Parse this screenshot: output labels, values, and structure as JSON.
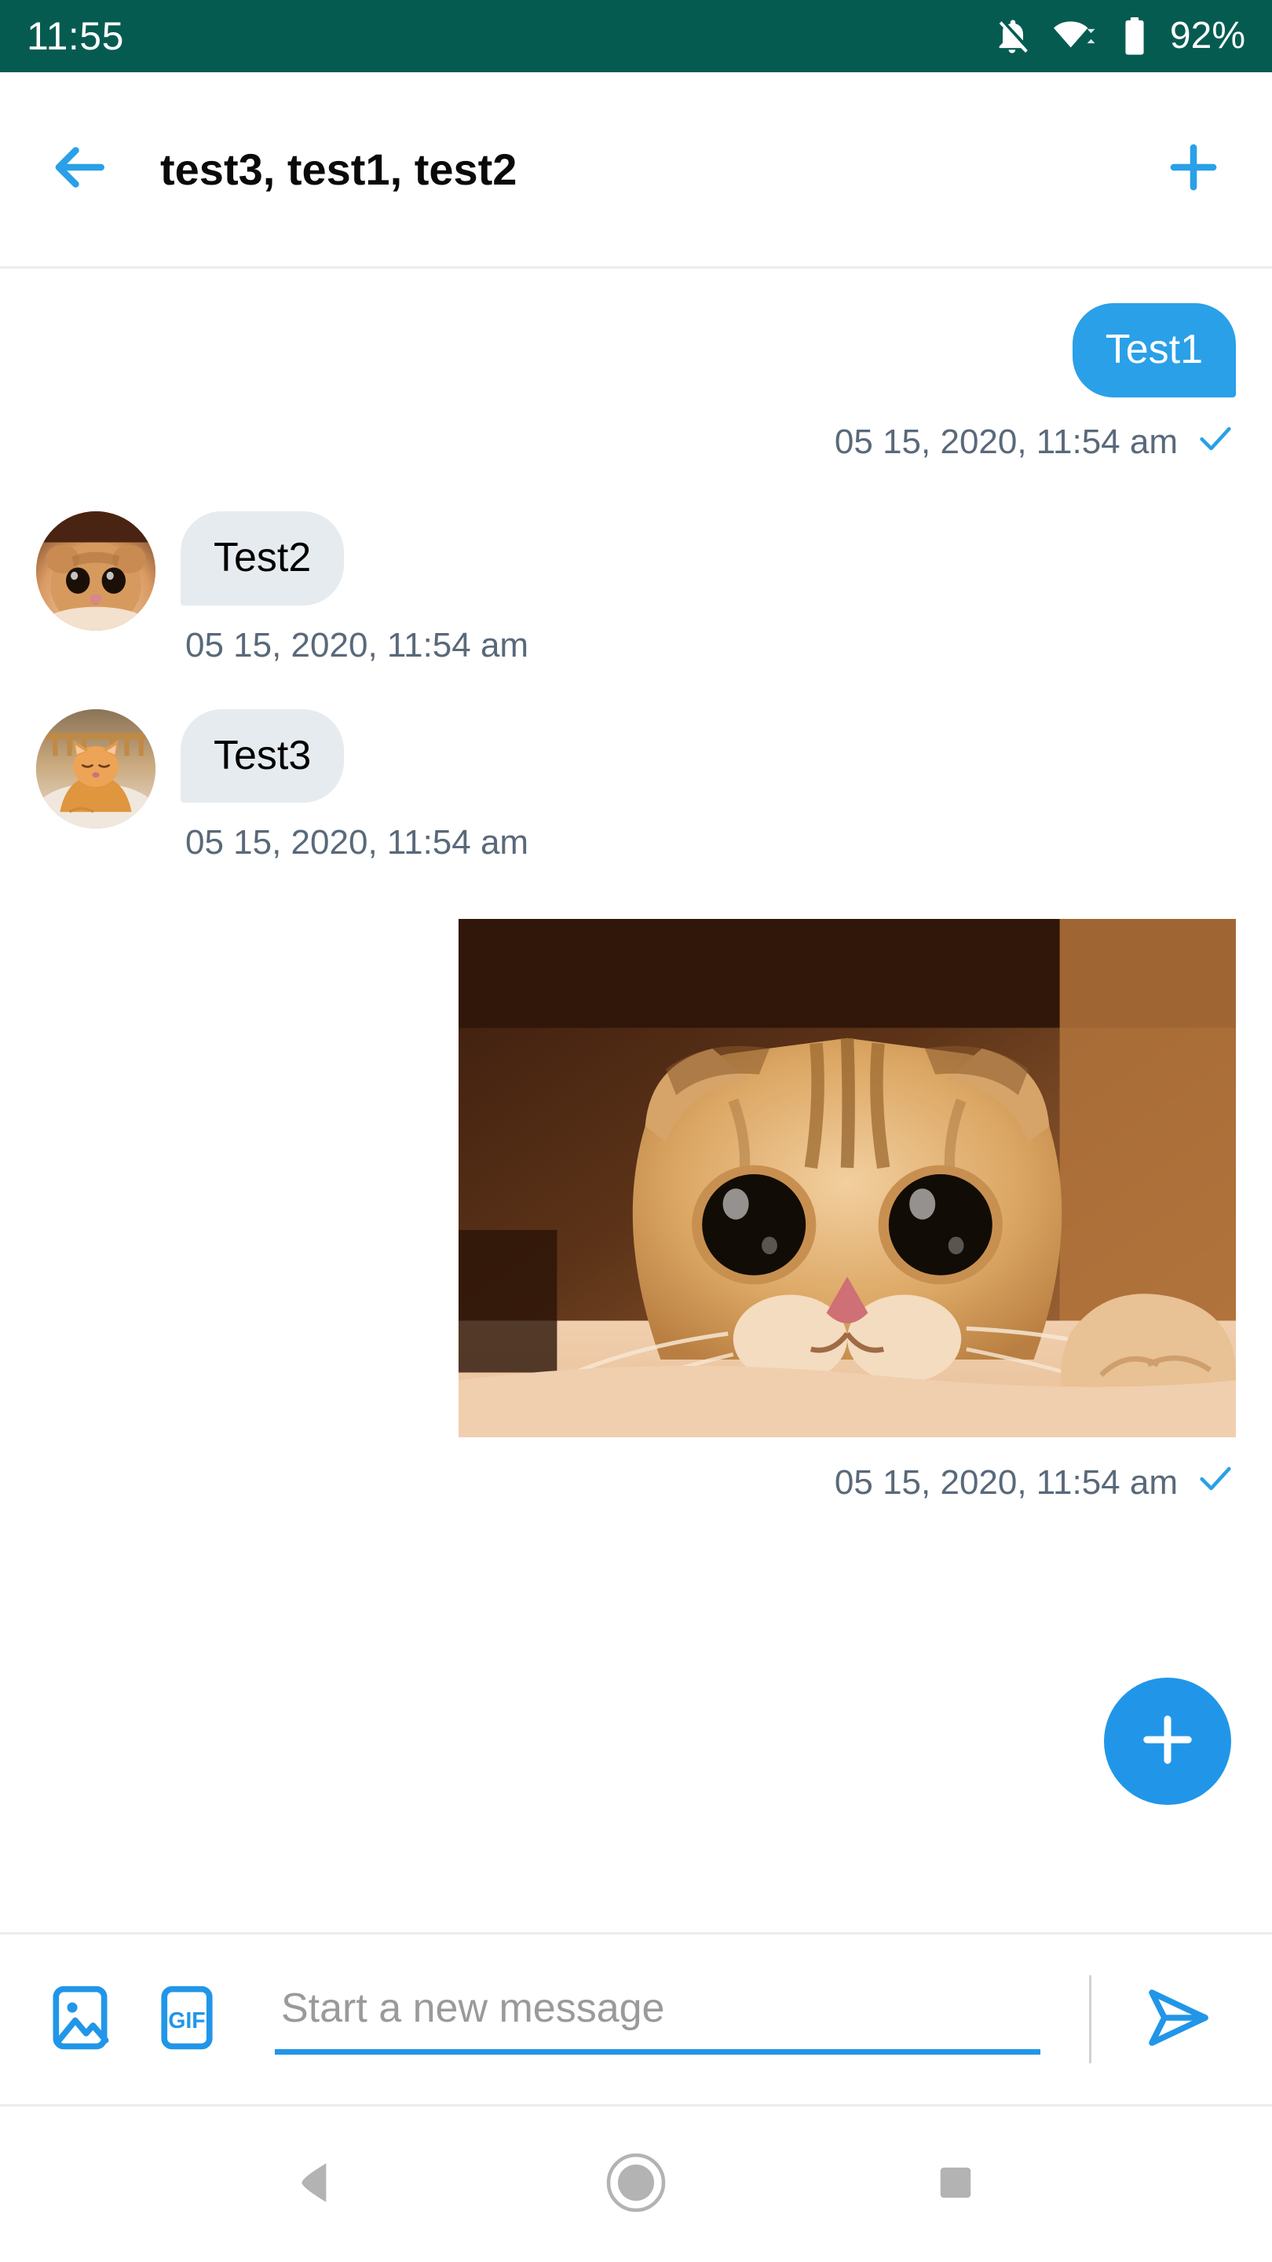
{
  "status_bar": {
    "time": "11:55",
    "battery_percent": "92%",
    "icons": [
      "notifications-off-icon",
      "wifi-icon",
      "battery-icon"
    ],
    "background_color": "#065B51"
  },
  "toolbar": {
    "back_label": "back-arrow",
    "title": "test3, test1, test2",
    "add_label": "add",
    "accent_color": "#2AA0E8"
  },
  "conversation": {
    "messages": [
      {
        "id": "m1",
        "direction": "outgoing",
        "type": "text",
        "text": "Test1",
        "timestamp": "05 15, 2020, 11:54 am",
        "status": "sent",
        "bubble_color": "#2AA0E8",
        "text_color": "#ffffff"
      },
      {
        "id": "m2",
        "direction": "incoming",
        "type": "text",
        "text": "Test2",
        "timestamp": "05 15, 2020, 11:54 am",
        "avatar": "cat-face-avatar",
        "bubble_color": "#E6EBEF",
        "text_color": "#000000"
      },
      {
        "id": "m3",
        "direction": "incoming",
        "type": "text",
        "text": "Test3",
        "timestamp": "05 15, 2020, 11:54 am",
        "avatar": "cat-lying-avatar",
        "bubble_color": "#E6EBEF",
        "text_color": "#000000"
      },
      {
        "id": "m4",
        "direction": "outgoing",
        "type": "image",
        "image_alt": "cat-photo",
        "timestamp": "05 15, 2020, 11:54 am",
        "status": "sent"
      }
    ],
    "timestamp_color": "#59697A"
  },
  "fab": {
    "label": "add",
    "color": "#2196E8"
  },
  "composer": {
    "image_button_label": "image",
    "gif_button_label": "GIF",
    "input_value": "",
    "input_placeholder": "Start a new message",
    "send_button_label": "send",
    "accent_color": "#2196E8",
    "placeholder_color": "#9a9a9a"
  },
  "nav_bar": {
    "back_label": "back",
    "home_label": "home",
    "recents_label": "recents",
    "color": "#b3b3b3"
  }
}
